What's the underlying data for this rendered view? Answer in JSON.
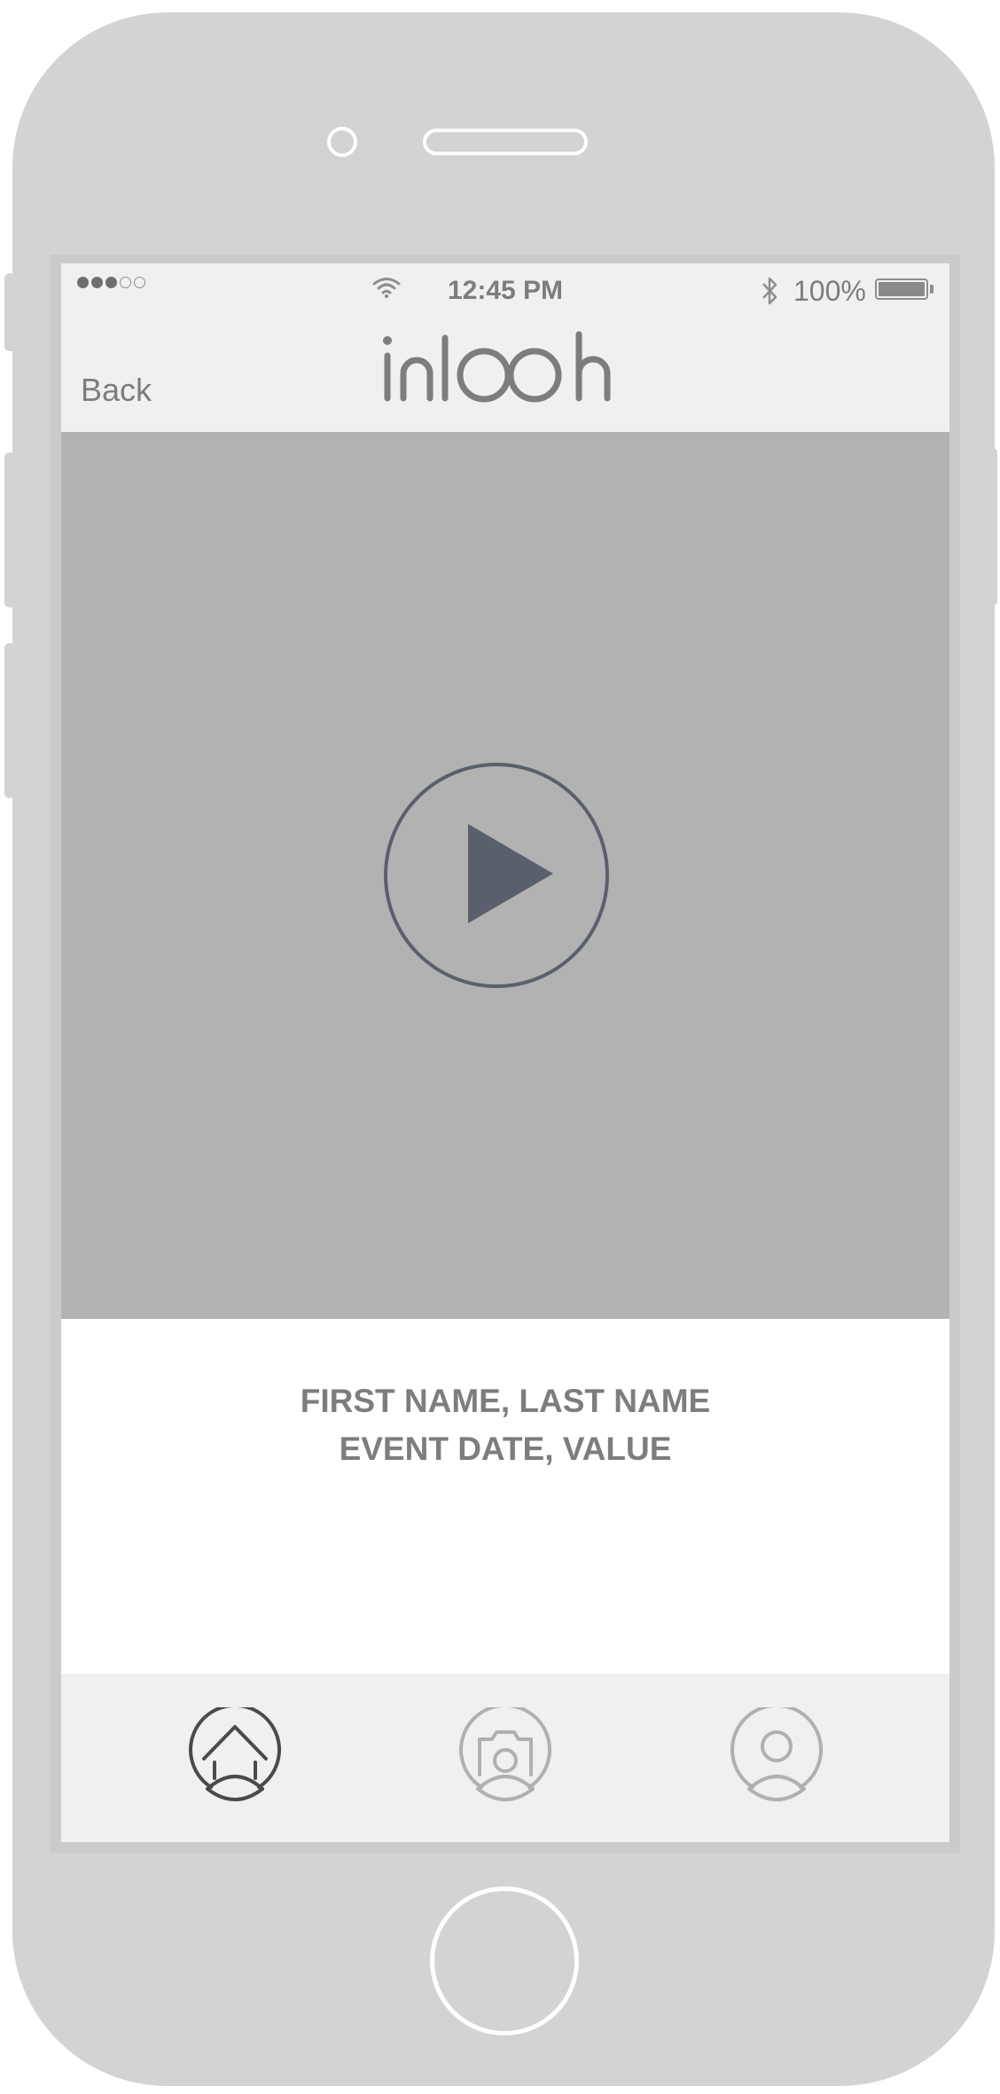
{
  "status_bar": {
    "time": "12:45 PM",
    "battery_percent": "100%",
    "signal_strength": "3 of 5",
    "icons": [
      "signal-dots-icon",
      "wifi-icon",
      "bluetooth-icon",
      "battery-icon"
    ]
  },
  "nav": {
    "back_label": "Back",
    "logo_text": "inlooh"
  },
  "video": {
    "icon": "play-icon"
  },
  "info": {
    "line1": "FIRST NAME, LAST NAME",
    "line2": "EVENT DATE, VALUE"
  },
  "tabbar": {
    "tabs": [
      {
        "icon": "home-icon",
        "active": true
      },
      {
        "icon": "camera-user-icon",
        "active": false
      },
      {
        "icon": "profile-icon",
        "active": false
      }
    ]
  },
  "colors": {
    "device_body": "#d2d3d5",
    "header_bg": "#f0f0f0",
    "video_bg": "#b2b2b2",
    "text_gray": "#7d7d7d",
    "play_icon": "#5a606b",
    "active_tab": "#4a4a4a",
    "inactive_tab": "#b0b0b0"
  }
}
